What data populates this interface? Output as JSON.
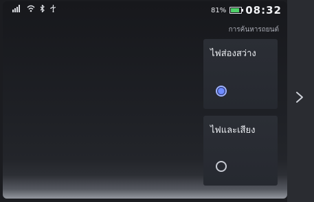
{
  "status": {
    "icons": [
      "signal-icon",
      "wifi-icon",
      "bluetooth-icon",
      "usb-icon"
    ],
    "battery_percent": "81%",
    "battery_level": 0.81,
    "time": "08:32"
  },
  "header": {
    "subtitle": "การค้นหารถยนต์"
  },
  "options": [
    {
      "label": "ไฟส่องสว่าง",
      "selected": true
    },
    {
      "label": "ไฟและเสียง",
      "selected": false
    }
  ],
  "colors": {
    "accent": "#6f8cff",
    "battery": "#4fd16a"
  },
  "navigation": {
    "next_icon": "chevron-right-icon"
  }
}
